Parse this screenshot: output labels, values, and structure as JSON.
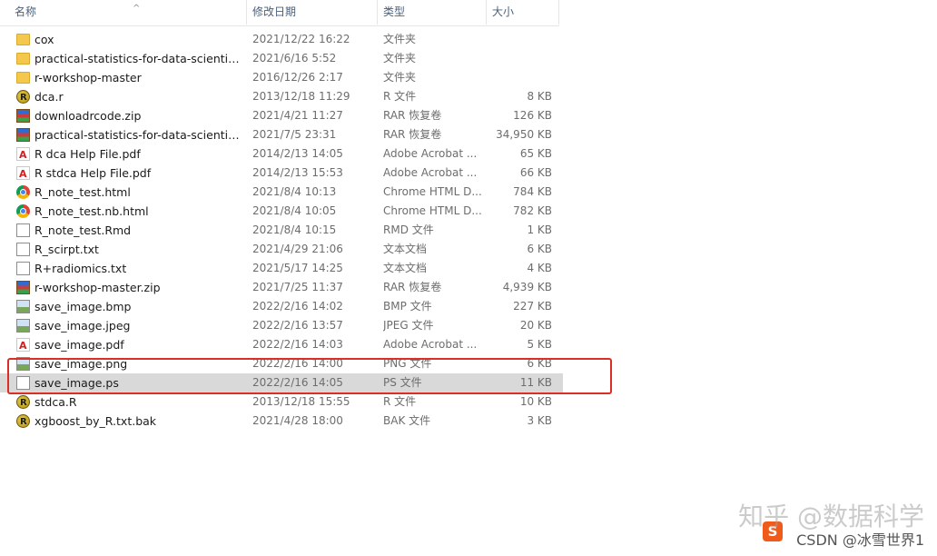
{
  "header": {
    "col_name": "名称",
    "col_date": "修改日期",
    "col_type": "类型",
    "col_size": "大小",
    "sort_arrow": "^"
  },
  "files": [
    {
      "icon": "folder-icon",
      "name": "cox",
      "date": "2021/12/22 16:22",
      "type": "文件夹",
      "size": ""
    },
    {
      "icon": "folder-icon",
      "name": "practical-statistics-for-data-scientists...",
      "date": "2021/6/16 5:52",
      "type": "文件夹",
      "size": ""
    },
    {
      "icon": "folder-icon",
      "name": "r-workshop-master",
      "date": "2016/12/26 2:17",
      "type": "文件夹",
      "size": ""
    },
    {
      "icon": "r-file-icon",
      "name": "dca.r",
      "date": "2013/12/18 11:29",
      "type": "R 文件",
      "size": "8 KB"
    },
    {
      "icon": "rar-archive-icon",
      "name": "downloadrcode.zip",
      "date": "2021/4/21 11:27",
      "type": "RAR 恢复卷",
      "size": "126 KB"
    },
    {
      "icon": "rar-archive-icon",
      "name": "practical-statistics-for-data-scientists...",
      "date": "2021/7/5 23:31",
      "type": "RAR 恢复卷",
      "size": "34,950 KB"
    },
    {
      "icon": "pdf-icon",
      "name": "R dca Help File.pdf",
      "date": "2014/2/13 14:05",
      "type": "Adobe Acrobat ...",
      "size": "65 KB"
    },
    {
      "icon": "pdf-icon",
      "name": "R stdca Help File.pdf",
      "date": "2014/2/13 15:53",
      "type": "Adobe Acrobat ...",
      "size": "66 KB"
    },
    {
      "icon": "chrome-html-icon",
      "name": "R_note_test.html",
      "date": "2021/8/4 10:13",
      "type": "Chrome HTML D...",
      "size": "784 KB"
    },
    {
      "icon": "chrome-html-icon",
      "name": "R_note_test.nb.html",
      "date": "2021/8/4 10:05",
      "type": "Chrome HTML D...",
      "size": "782 KB"
    },
    {
      "icon": "document-icon",
      "name": "R_note_test.Rmd",
      "date": "2021/8/4 10:15",
      "type": "RMD 文件",
      "size": "1 KB"
    },
    {
      "icon": "text-file-icon",
      "name": "R_scirpt.txt",
      "date": "2021/4/29 21:06",
      "type": "文本文档",
      "size": "6 KB"
    },
    {
      "icon": "text-file-icon",
      "name": "R+radiomics.txt",
      "date": "2021/5/17 14:25",
      "type": "文本文档",
      "size": "4 KB"
    },
    {
      "icon": "rar-archive-icon",
      "name": "r-workshop-master.zip",
      "date": "2021/7/25 11:37",
      "type": "RAR 恢复卷",
      "size": "4,939 KB"
    },
    {
      "icon": "image-file-icon",
      "name": "save_image.bmp",
      "date": "2022/2/16 14:02",
      "type": "BMP 文件",
      "size": "227 KB"
    },
    {
      "icon": "image-file-icon",
      "name": "save_image.jpeg",
      "date": "2022/2/16 13:57",
      "type": "JPEG 文件",
      "size": "20 KB"
    },
    {
      "icon": "pdf-icon",
      "name": "save_image.pdf",
      "date": "2022/2/16 14:03",
      "type": "Adobe Acrobat ...",
      "size": "5 KB"
    },
    {
      "icon": "image-file-icon",
      "name": "save_image.png",
      "date": "2022/2/16 14:00",
      "type": "PNG 文件",
      "size": "6 KB"
    },
    {
      "icon": "document-icon",
      "name": "save_image.ps",
      "date": "2022/2/16 14:05",
      "type": "PS 文件",
      "size": "11 KB",
      "selected": true
    },
    {
      "icon": "r-file-icon",
      "name": "stdca.R",
      "date": "2013/12/18 15:55",
      "type": "R 文件",
      "size": "10 KB"
    },
    {
      "icon": "r-file-icon",
      "name": "xgboost_by_R.txt.bak",
      "date": "2021/4/28 18:00",
      "type": "BAK 文件",
      "size": "3 KB"
    }
  ],
  "watermark": {
    "line1": "知乎 @数据科学",
    "line2": "CSDN @冰雪世界1",
    "logo": "S"
  },
  "colors": {
    "selection": "#d9d9d9",
    "highlight_box": "#d93025",
    "header_text": "#4c607a"
  }
}
